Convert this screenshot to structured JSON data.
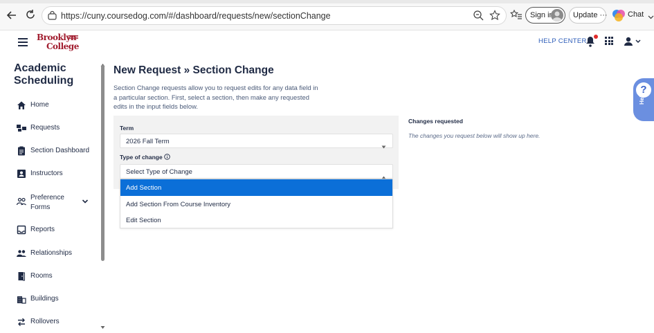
{
  "browser": {
    "url": "https://cuny.coursedog.com/#/dashboard/requests/new/sectionChange",
    "signin_label": "Sign in",
    "update_label": "Update",
    "chat_label": "Chat"
  },
  "header": {
    "logo_line1": "Brooklyn",
    "logo_line2": "College",
    "help_center": "HELP CENTER"
  },
  "sidebar": {
    "title": "Academic Scheduling",
    "items": [
      {
        "label": "Home",
        "icon": "home-icon"
      },
      {
        "label": "Requests",
        "icon": "requests-icon"
      },
      {
        "label": "Section Dashboard",
        "icon": "clipboard-icon"
      },
      {
        "label": "Instructors",
        "icon": "contact-card-icon"
      },
      {
        "label": "Preference Forms",
        "icon": "people-icon"
      },
      {
        "label": "Reports",
        "icon": "inbox-icon"
      },
      {
        "label": "Relationships",
        "icon": "group-icon"
      },
      {
        "label": "Rooms",
        "icon": "door-icon"
      },
      {
        "label": "Buildings",
        "icon": "building-icon"
      },
      {
        "label": "Rollovers",
        "icon": "swap-icon"
      }
    ]
  },
  "main": {
    "title": "New Request » Section Change",
    "description": "Section Change requests allow you to request edits for any data field in a particular section. First, select a section, then make any requested edits in the input fields below.",
    "term_label": "Term",
    "term_value": "2026 Fall Term",
    "type_label": "Type of change",
    "type_placeholder": "Select Type of Change",
    "type_options": [
      "Add Section",
      "Add Section From Course Inventory",
      "Edit Section"
    ],
    "changes_title": "Changes requested",
    "changes_note": "The changes you request below will show up here."
  },
  "help_widget": {
    "label": "Help"
  },
  "colors": {
    "accent": "#0b6fd8",
    "brand": "#a11c2e",
    "text": "#1f2a44",
    "help_widget": "#6b8fe0"
  }
}
